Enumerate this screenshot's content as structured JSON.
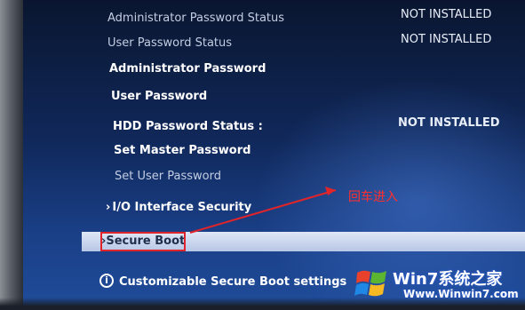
{
  "bios": {
    "items": [
      {
        "label": "Administrator Password Status",
        "value": "NOT INSTALLED"
      },
      {
        "label": "User Password Status",
        "value": "NOT INSTALLED"
      },
      {
        "label": "Administrator Password"
      },
      {
        "label": "User Password"
      },
      {
        "label": "HDD Password Status  :",
        "value": "NOT INSTALLED"
      },
      {
        "label": "Set Master Password"
      },
      {
        "label": "Set User Password"
      },
      {
        "label": "I/O Interface Security"
      },
      {
        "label": "Secure Boot"
      }
    ],
    "help_text": "Customizable Secure Boot settings",
    "help_icon": "info-icon"
  },
  "annotation": {
    "text": "回车进入"
  },
  "watermark": {
    "brand": "Win7系统之家",
    "url": "Www.Winwin7.com"
  },
  "colors": {
    "annotation": "#e0242a",
    "highlight": "#c8d4ee",
    "text": "#ffffff"
  }
}
